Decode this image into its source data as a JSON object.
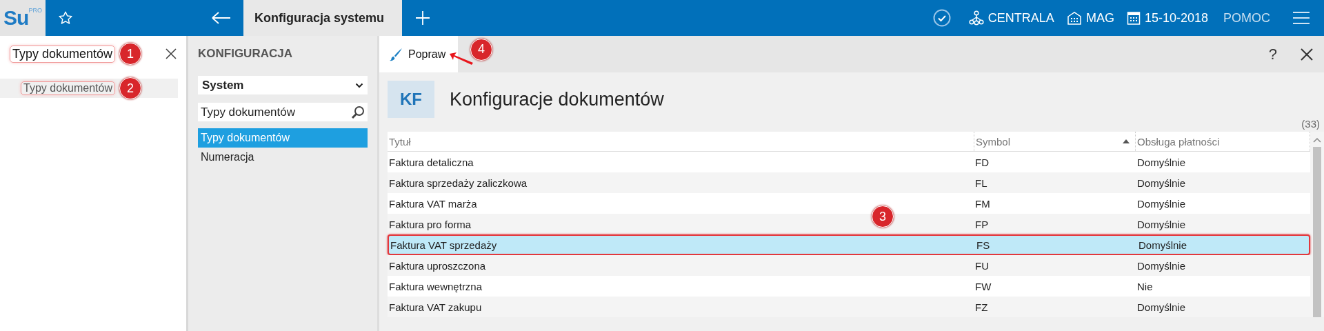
{
  "app": {
    "logo": "Su",
    "logo_sup": "PRO"
  },
  "tabs": [
    {
      "label": "Konfiguracja systemu",
      "selected": true
    }
  ],
  "status_items": [
    {
      "kind": "network",
      "label": "CENTRALA"
    },
    {
      "kind": "warehouse",
      "label": "MAG"
    },
    {
      "kind": "calendar",
      "label": "15-10-2018"
    },
    {
      "kind": "help",
      "label": "POMOC"
    }
  ],
  "search": {
    "value": "Typy dokumentów",
    "outlined": true,
    "annotation": "1"
  },
  "search_results": [
    {
      "label": "Typy dokumentów",
      "outlined": true,
      "annotation": "2"
    }
  ],
  "config_panel": {
    "title": "KONFIGURACJA",
    "dropdown": "System",
    "filter": "Typy dokumentów",
    "items": [
      {
        "label": "Typy dokumentów",
        "selected": true
      },
      {
        "label": "Numeracja",
        "selected": false
      }
    ]
  },
  "toolbar": {
    "button": "Popraw",
    "annotation": "4",
    "help": "?"
  },
  "document": {
    "badge": "KF",
    "title": "Konfiguracje dokumentów",
    "count": "(33)"
  },
  "table": {
    "columns": [
      {
        "label": "Tytuł",
        "sorted": false
      },
      {
        "label": "Symbol",
        "sorted": true
      },
      {
        "label": "Obsługa płatności",
        "sorted": false
      }
    ],
    "rows": [
      {
        "cells": [
          "Faktura detaliczna",
          "FD",
          "Domyślnie"
        ],
        "selected": false,
        "outlined": false
      },
      {
        "cells": [
          "Faktura sprzedaży zaliczkowa",
          "FL",
          "Domyślnie"
        ],
        "selected": false,
        "outlined": false
      },
      {
        "cells": [
          "Faktura VAT marża",
          "FM",
          "Domyślnie"
        ],
        "selected": false,
        "outlined": false
      },
      {
        "cells": [
          "Faktura pro forma",
          "FP",
          "Domyślnie"
        ],
        "selected": false,
        "outlined": false
      },
      {
        "cells": [
          "Faktura VAT sprzedaży",
          "FS",
          "Domyślnie"
        ],
        "selected": true,
        "outlined": true,
        "annotation": "3"
      },
      {
        "cells": [
          "Faktura uproszczona",
          "FU",
          "Domyślnie"
        ],
        "selected": false,
        "outlined": false
      },
      {
        "cells": [
          "Faktura wewnętrzna",
          "FW",
          "Nie"
        ],
        "selected": false,
        "outlined": false
      },
      {
        "cells": [
          "Faktura VAT zakupu",
          "FZ",
          "Domyślnie"
        ],
        "selected": false,
        "outlined": false
      }
    ]
  }
}
